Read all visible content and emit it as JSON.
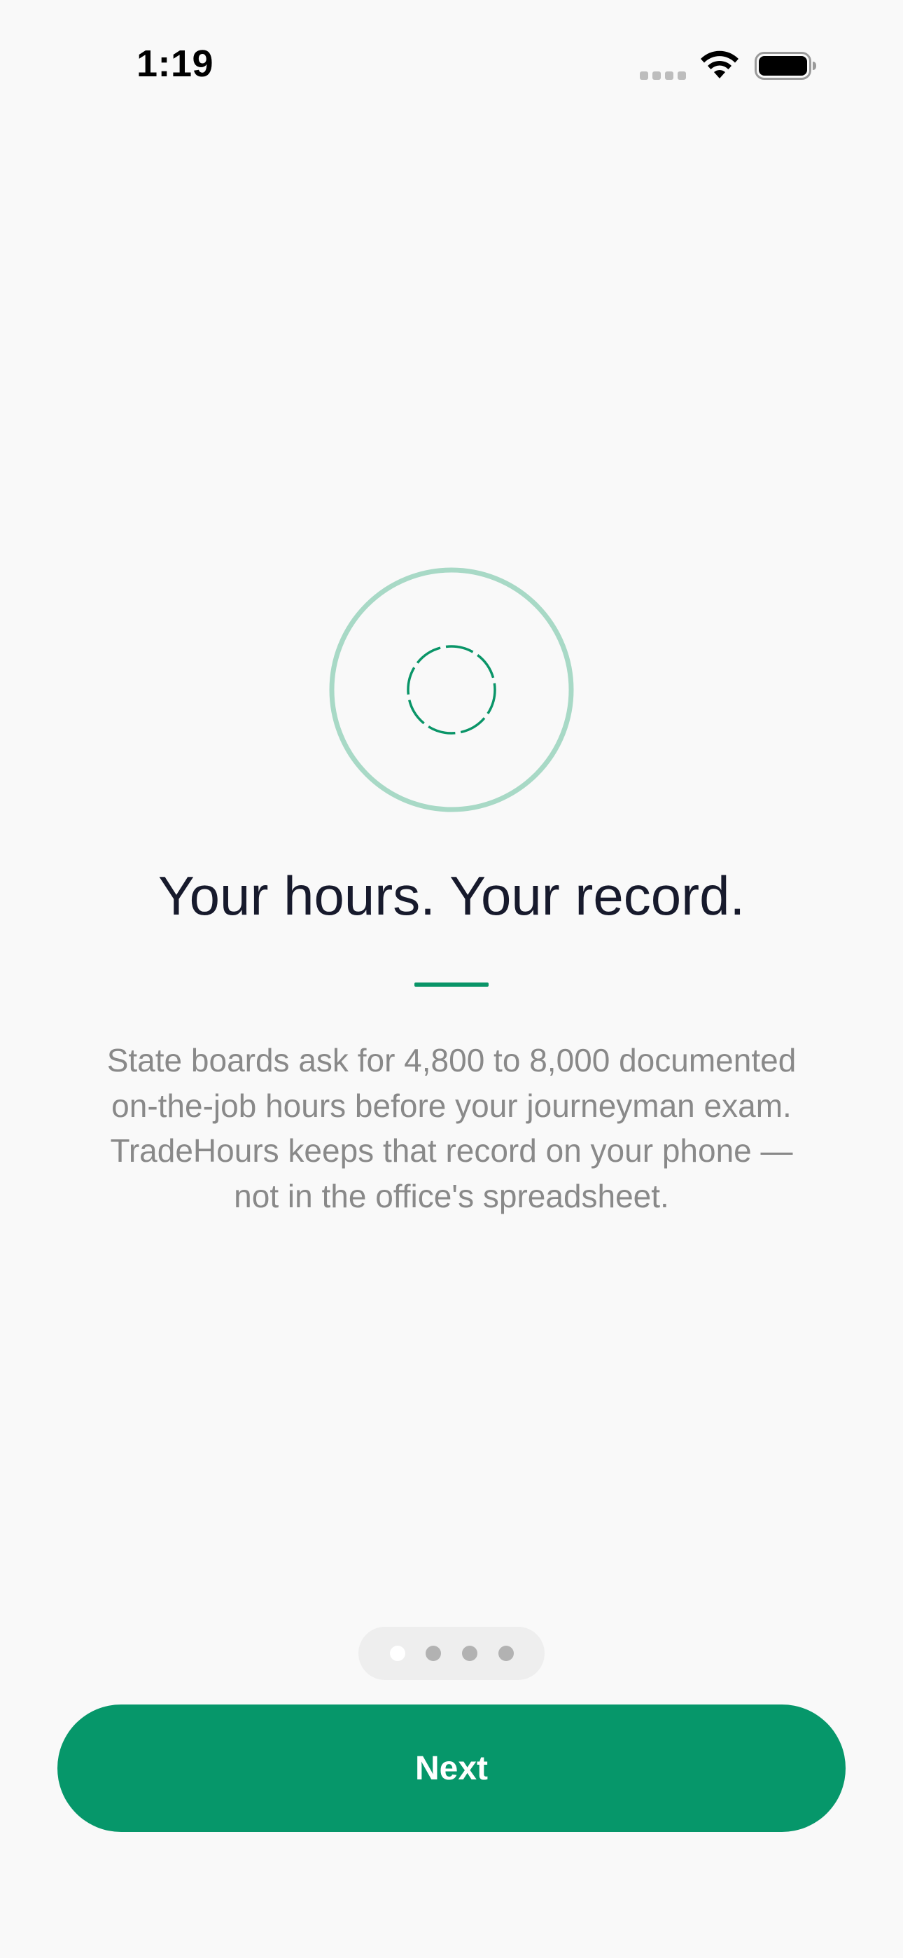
{
  "status_bar": {
    "time": "1:19",
    "icons": [
      "signal-dots-icon",
      "wifi-icon",
      "battery-icon"
    ]
  },
  "onboarding": {
    "icon": "target-circle-icon",
    "title": "Your hours. Your record.",
    "body": "State boards ask for 4,800 to 8,000 documented on-the-job hours before your journeyman exam. TradeHours keeps that record on your phone — not in the office's spreadsheet.",
    "page_indicator": {
      "total_pages": 4,
      "current_page": 1
    },
    "next_label": "Next"
  },
  "colors": {
    "accent": "#06976a",
    "accent_light": "#a8d9c6",
    "title": "#171a2c",
    "body_text": "#898989",
    "background": "#f9f9f9"
  }
}
